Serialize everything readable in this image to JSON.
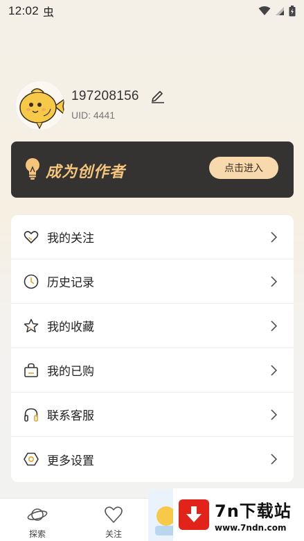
{
  "status_bar": {
    "time": "12:02",
    "notification_glyph": "虫"
  },
  "profile": {
    "username": "197208156",
    "uid": "UID: 4441"
  },
  "creator_banner": {
    "title": "成为创作者",
    "button": "点击进入",
    "accent_color": "#f6c57c",
    "background": "#343331"
  },
  "menu": {
    "items": [
      {
        "label": "我的关注",
        "icon": "heart-icon"
      },
      {
        "label": "历史记录",
        "icon": "clock-icon"
      },
      {
        "label": "我的收藏",
        "icon": "star-icon"
      },
      {
        "label": "我的已购",
        "icon": "shopping-bag-icon"
      },
      {
        "label": "联系客服",
        "icon": "headset-icon"
      },
      {
        "label": "更多设置",
        "icon": "settings-hexagon-icon"
      }
    ]
  },
  "bottom_nav": {
    "items": [
      {
        "label": "探索",
        "icon": "planet-icon"
      },
      {
        "label": "关注",
        "icon": "heart-icon"
      }
    ]
  },
  "watermark": {
    "title": "7n下载站",
    "url": "www.7ndn.com",
    "brand_color": "#e2231a"
  }
}
